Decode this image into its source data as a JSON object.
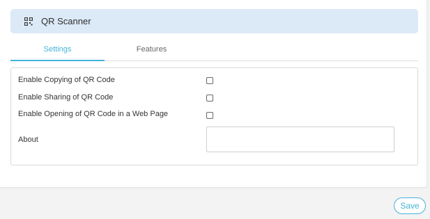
{
  "header": {
    "title": "QR Scanner",
    "icon": "qr-code-icon"
  },
  "tabs": [
    {
      "label": "Settings",
      "active": true
    },
    {
      "label": "Features",
      "active": false
    }
  ],
  "settings": {
    "rows": [
      {
        "label": "Enable Copying of QR Code",
        "checked": false
      },
      {
        "label": "Enable Sharing of QR Code",
        "checked": false
      },
      {
        "label": "Enable Opening of QR Code in a Web Page",
        "checked": false
      }
    ],
    "about": {
      "label": "About",
      "value": "",
      "placeholder": ""
    }
  },
  "footer": {
    "save_label": "Save"
  },
  "colors": {
    "accent": "#44b3d8",
    "header_bg": "#dce9f6"
  }
}
